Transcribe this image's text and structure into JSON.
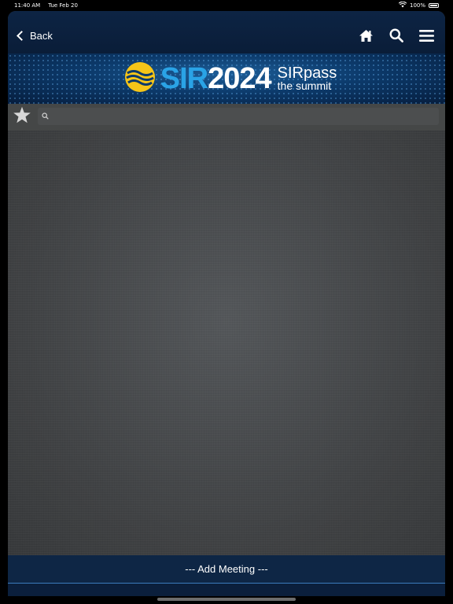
{
  "status_bar": {
    "time": "11:40 AM",
    "date": "Tue Feb 20",
    "battery": "100%"
  },
  "nav": {
    "back_label": "Back",
    "icons": [
      "home-icon",
      "search-icon",
      "menu-icon"
    ]
  },
  "banner": {
    "logo_sir": "SIR",
    "logo_year": "2024",
    "logo_line1": "SIRpass",
    "logo_line2": "the summit"
  },
  "search": {
    "placeholder": "",
    "value": ""
  },
  "footer": {
    "add_meeting_label": "--- Add Meeting ---"
  },
  "colors": {
    "navbar": "#0d2444",
    "banner_accent": "#2aa3e6",
    "logo_yellow": "#f5c518",
    "content_bg": "#464849"
  }
}
